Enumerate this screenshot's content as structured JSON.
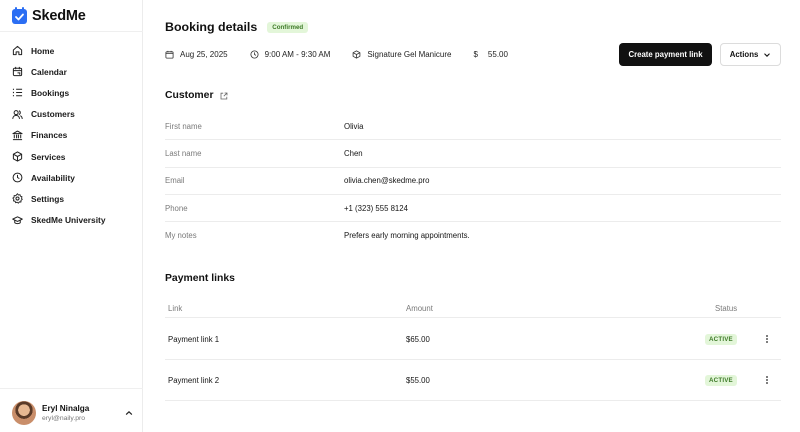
{
  "brand": {
    "name": "SkedMe"
  },
  "sidebar": {
    "items": [
      {
        "label": "Home",
        "icon": "home-icon"
      },
      {
        "label": "Calendar",
        "icon": "calendar-icon"
      },
      {
        "label": "Bookings",
        "icon": "list-icon"
      },
      {
        "label": "Customers",
        "icon": "users-icon"
      },
      {
        "label": "Finances",
        "icon": "bank-icon"
      },
      {
        "label": "Services",
        "icon": "box-icon"
      },
      {
        "label": "Availability",
        "icon": "clock-icon"
      },
      {
        "label": "Settings",
        "icon": "gear-icon"
      },
      {
        "label": "SkedMe University",
        "icon": "graduation-cap-icon"
      }
    ]
  },
  "user": {
    "name": "Eryl Ninalga",
    "email": "eryl@naily.pro"
  },
  "booking": {
    "title": "Booking details",
    "status": "Confirmed",
    "date": "Aug 25, 2025",
    "time": "9:00 AM - 9:30 AM",
    "service": "Signature Gel Manicure",
    "price_symbol": "$",
    "price": "55.00",
    "create_link_label": "Create payment link",
    "actions_label": "Actions"
  },
  "customer": {
    "title": "Customer",
    "fields": [
      {
        "label": "First name",
        "value": "Olivia"
      },
      {
        "label": "Last name",
        "value": "Chen"
      },
      {
        "label": "Email",
        "value": "olivia.chen@skedme.pro"
      },
      {
        "label": "Phone",
        "value": "+1 (323) 555 8124"
      },
      {
        "label": "My notes",
        "value": "Prefers early morning appointments."
      }
    ]
  },
  "payment_links": {
    "title": "Payment links",
    "columns": {
      "link": "Link",
      "amount": "Amount",
      "status": "Status"
    },
    "rows": [
      {
        "link": "Payment link 1",
        "amount": "$65.00",
        "status": "ACTIVE"
      },
      {
        "link": "Payment link 2",
        "amount": "$55.00",
        "status": "ACTIVE"
      }
    ]
  },
  "colors": {
    "accent": "#2b6ef3",
    "primary_button": "#111111",
    "badge_bg": "#e3f6d9",
    "badge_text": "#3d7a27"
  }
}
